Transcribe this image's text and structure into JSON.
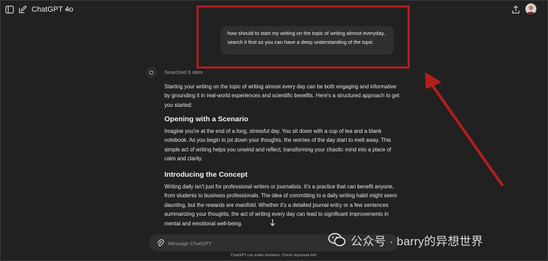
{
  "topbar": {
    "model_name": "ChatGPT 4o"
  },
  "user_message": {
    "text": "how should to start my writing on the topic of writing almost everyday, search it first so you can have a deep understanding of the topic"
  },
  "assistant": {
    "status": "Searched 6 sites",
    "intro": "Starting your writing on the topic of writing almost every day can be both engaging and informative by grounding it in real-world experiences and scientific benefits. Here's a structured approach to get you started:",
    "section1_heading": "Opening with a Scenario",
    "section1_text": "Imagine you're at the end of a long, stressful day. You sit down with a cup of tea and a blank notebook. As you begin to jot down your thoughts, the worries of the day start to melt away. This simple act of writing helps you unwind and reflect, transforming your chaotic mind into a place of calm and clarity.",
    "section2_heading": "Introducing the Concept",
    "section2_text": "Writing daily isn't just for professional writers or journalists. It's a practice that can benefit anyone, from students to business professionals. The idea of committing to a daily writing habit might seem daunting, but the rewards are manifold. Whether it's a detailed journal entry or a few sentences summarizing your thoughts, the act of writing every day can lead to significant improvements in mental and emotional well-being."
  },
  "composer": {
    "placeholder": "Message ChatGPT"
  },
  "footer": {
    "disclaimer": "ChatGPT can make mistakes. Check important info."
  },
  "watermark": {
    "text": "公众号 · barry的异想世界"
  },
  "colors": {
    "background": "#212121",
    "bubble": "#2f2f2f",
    "annotation_red": "#b31e1e"
  }
}
